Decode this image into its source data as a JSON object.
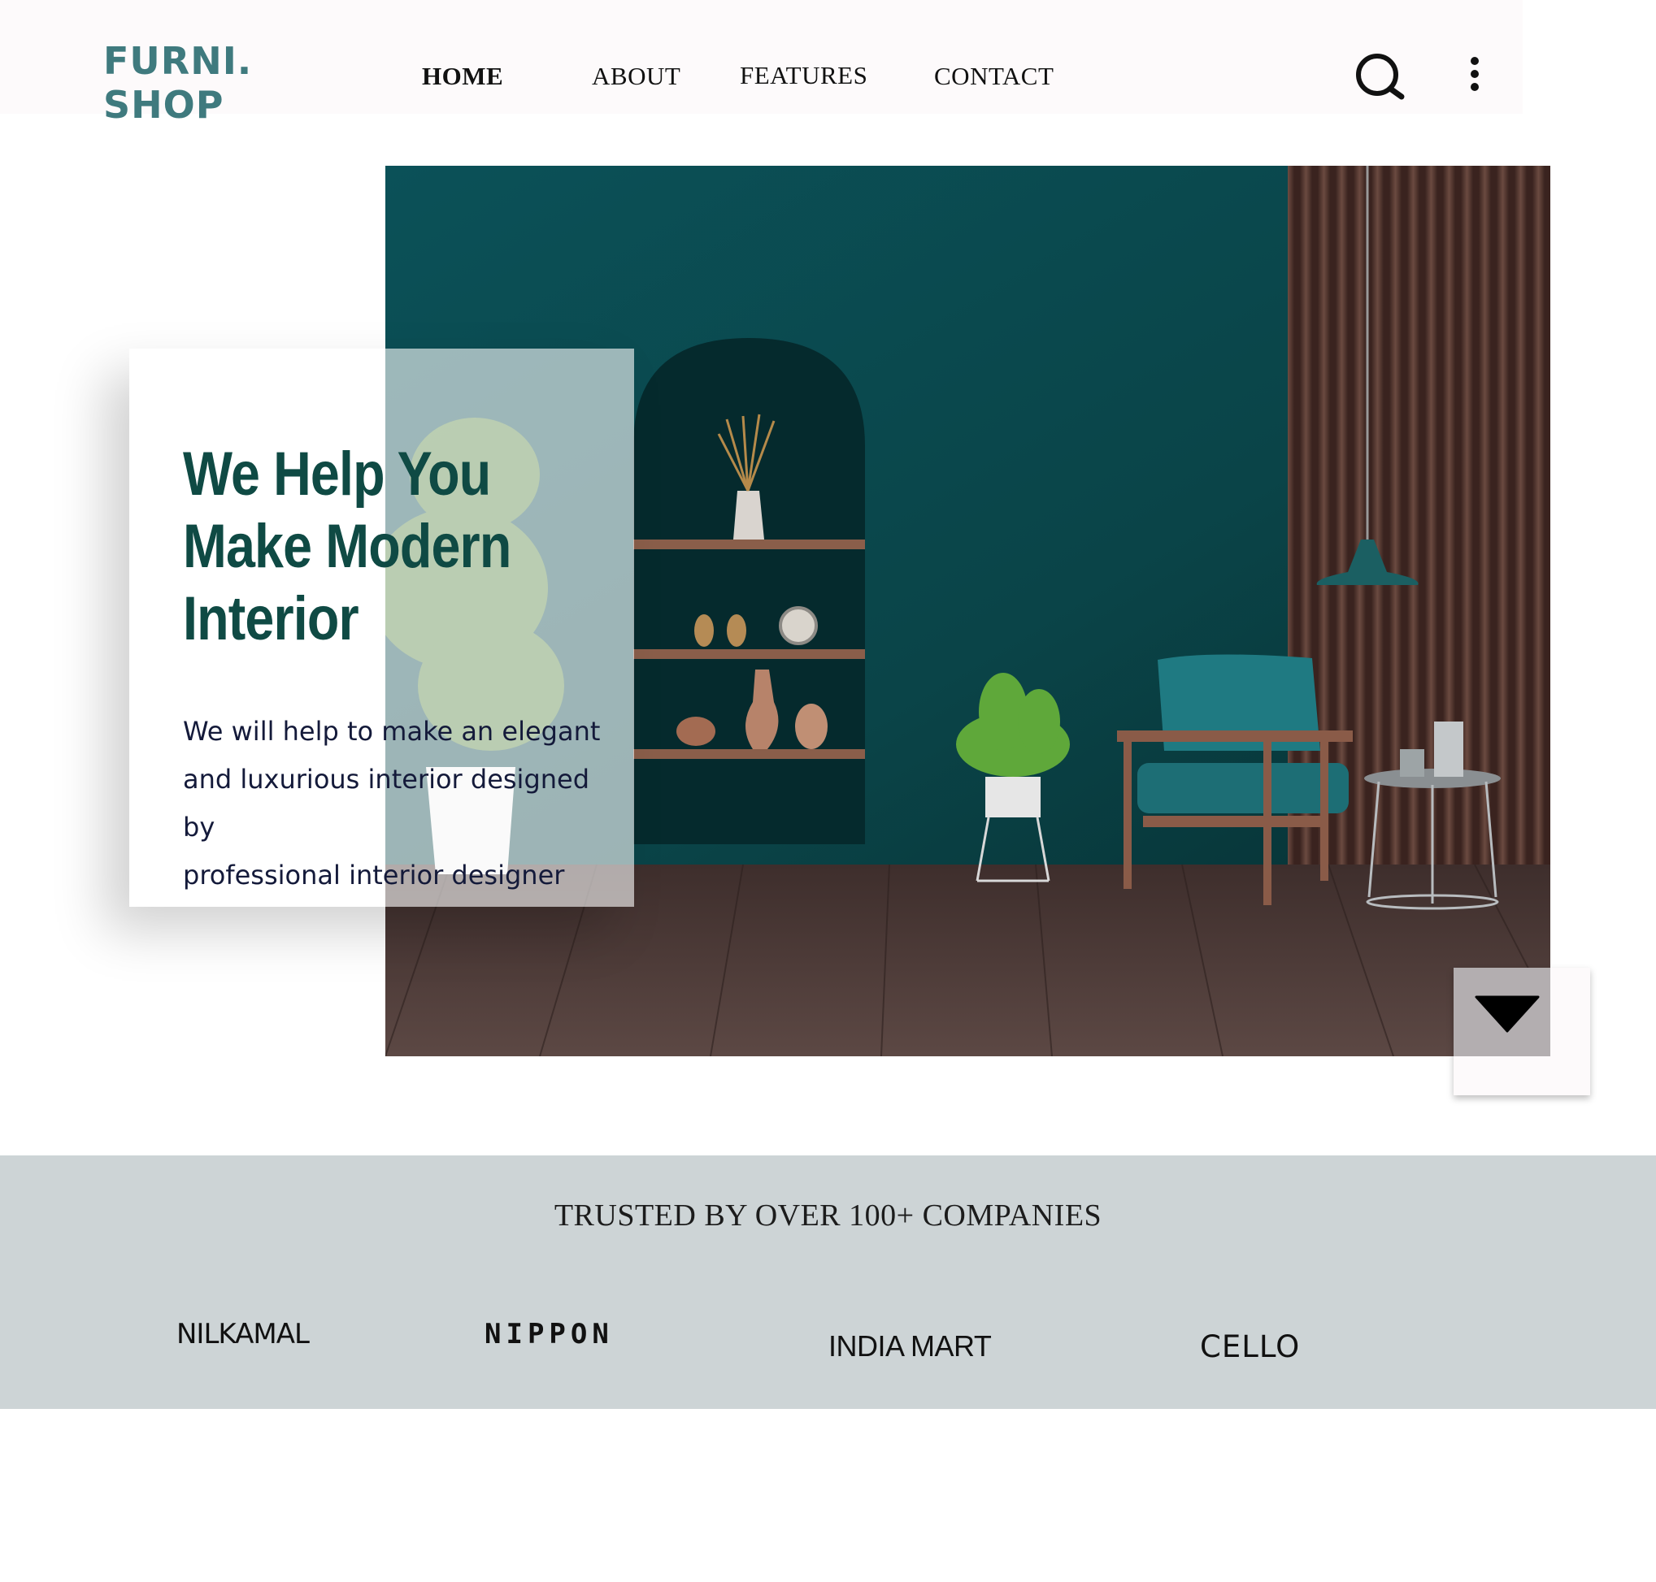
{
  "header": {
    "logo_line1": "FURNI.",
    "logo_line2": "SHOP",
    "nav": [
      "HOME",
      "ABOUT",
      "FEATURES",
      "CONTACT"
    ],
    "active_nav": "HOME",
    "icons": [
      "search-icon",
      "more-vertical-icon"
    ]
  },
  "hero": {
    "title_line1": "We Help You",
    "title_line2": "Make Modern",
    "title_line3": "Interior",
    "text_line1": "We will help to make an elegant",
    "text_line2": "and luxurious interior designed by",
    "text_line3": "professional interior designer",
    "scroll_icon": "caret-down-icon",
    "colors": {
      "title": "#0f4a44",
      "wall": "#0b4a4d",
      "floor": "#4a3633"
    }
  },
  "trusted": {
    "title": "TRUSTED BY OVER 100+ COMPANIES",
    "brands": [
      "NILKAMAL",
      "NIPPON",
      "INDIA MART",
      "CELLO"
    ]
  }
}
